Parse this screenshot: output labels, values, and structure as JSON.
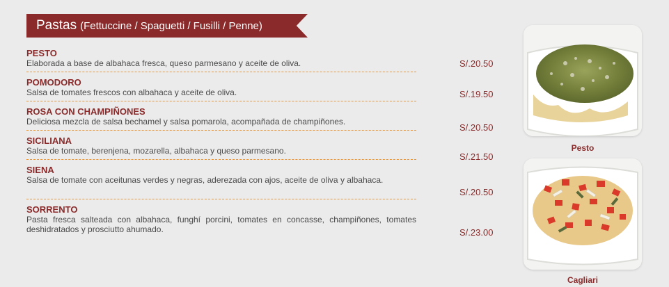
{
  "header": {
    "title": "Pastas",
    "subtitle": "(Fettuccine / Spaguetti / Fusilli / Penne)"
  },
  "items": [
    {
      "name": "PESTO",
      "description": "Elaborada a base de albahaca fresca, queso parmesano y aceite de oliva.",
      "price": "S/.20.50"
    },
    {
      "name": "POMODORO",
      "description": "Salsa de tomates frescos con albahaca y aceite de oliva.",
      "price": "S/.19.50"
    },
    {
      "name": "ROSA CON CHAMPIÑONES",
      "description": "Deliciosa mezcla de salsa bechamel y salsa pomarola, acompañada de champiñones.",
      "price": "S/.20.50"
    },
    {
      "name": "SICILIANA",
      "description": "Salsa de tomate, berenjena, mozarella, albahaca y queso parmesano.",
      "price": "S/.21.50"
    },
    {
      "name": "SIENA",
      "description": "Salsa de tomate con aceitunas verdes y negras, aderezada con ajos, aceite de oliva y albahaca.",
      "price": "S/.20.50"
    },
    {
      "name": "SORRENTO",
      "description": "Pasta fresca salteada con albahaca, funghí porcini, tomates en concasse, champiñones, tomates deshidratados y prosciutto ahumado.",
      "price": "S/.23.00"
    }
  ],
  "photos": [
    {
      "caption": "Pesto",
      "icon": "pesto-pasta-photo"
    },
    {
      "caption": "Cagliari",
      "icon": "cagliari-pasta-photo"
    }
  ],
  "colors": {
    "accent": "#8b2a2a",
    "divider": "#e8963a",
    "background": "#ebebeb"
  }
}
